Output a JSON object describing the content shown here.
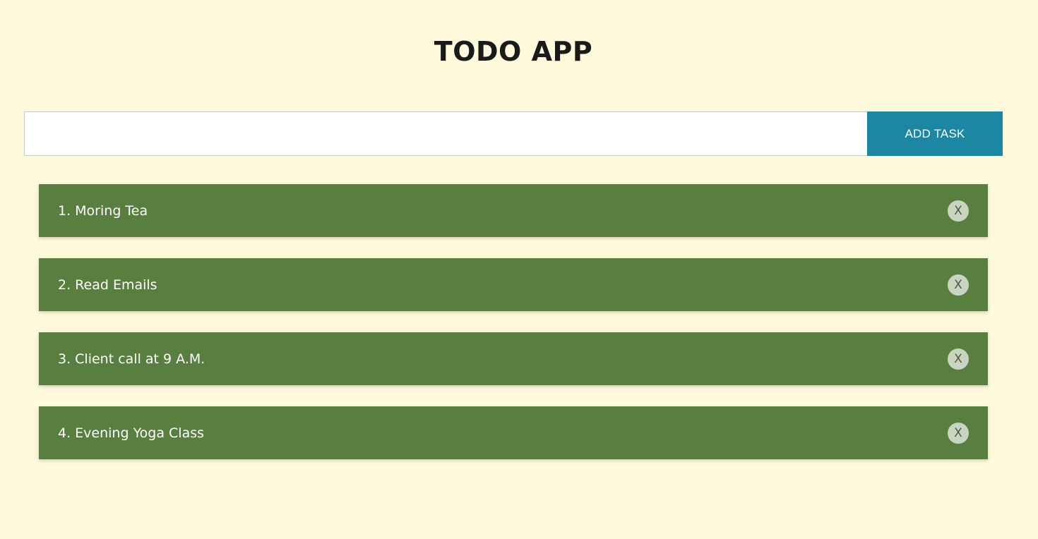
{
  "app": {
    "title": "TODO APP"
  },
  "form": {
    "input_value": "",
    "input_placeholder": "",
    "add_button_label": "ADD TASK"
  },
  "tasks": [
    {
      "label": "1. Moring Tea",
      "delete_label": "X"
    },
    {
      "label": "2. Read Emails",
      "delete_label": "X"
    },
    {
      "label": "3. Client call at 9 A.M.",
      "delete_label": "X"
    },
    {
      "label": "4. Evening Yoga Class",
      "delete_label": "X"
    }
  ],
  "colors": {
    "background": "#fffadb",
    "task_bg": "#587f40",
    "button_bg": "#1c87a3",
    "delete_bg": "#c9d5c1"
  },
  "icons": {
    "delete": "close-icon"
  }
}
